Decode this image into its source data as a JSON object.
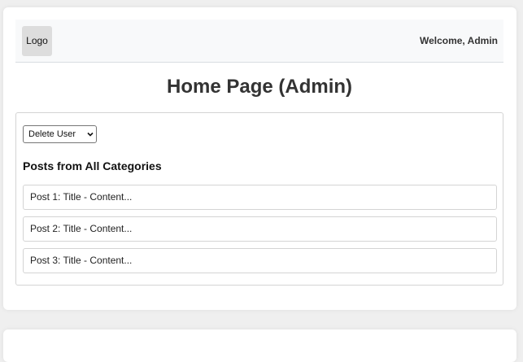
{
  "header": {
    "logo_label": "Logo",
    "welcome_text": "Welcome, Admin"
  },
  "main": {
    "title": "Home Page (Admin)",
    "action_select": {
      "selected": "Delete User",
      "icon": "chevron-down-icon"
    },
    "section_title": "Posts from All Categories",
    "posts": [
      "Post 1: Title - Content...",
      "Post 2: Title - Content...",
      "Post 3: Title - Content..."
    ]
  }
}
